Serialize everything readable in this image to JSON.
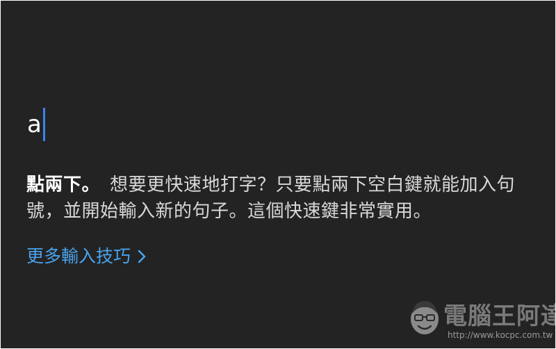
{
  "editor": {
    "typed_text": "a"
  },
  "tip": {
    "title": "點兩下。",
    "body": "想要更快速地打字？只要點兩下空白鍵就能加入句號，並開始輸入新的句子。這個快速鍵非常實用。"
  },
  "link": {
    "label": "更多輸入技巧",
    "icon": "chevron-right-icon"
  },
  "watermark": {
    "name": "電腦王阿達",
    "url": "http://www.kocpc.com.tw"
  },
  "colors": {
    "background": "#232323",
    "caret": "#3a82f7",
    "link": "#4aa3ec"
  }
}
